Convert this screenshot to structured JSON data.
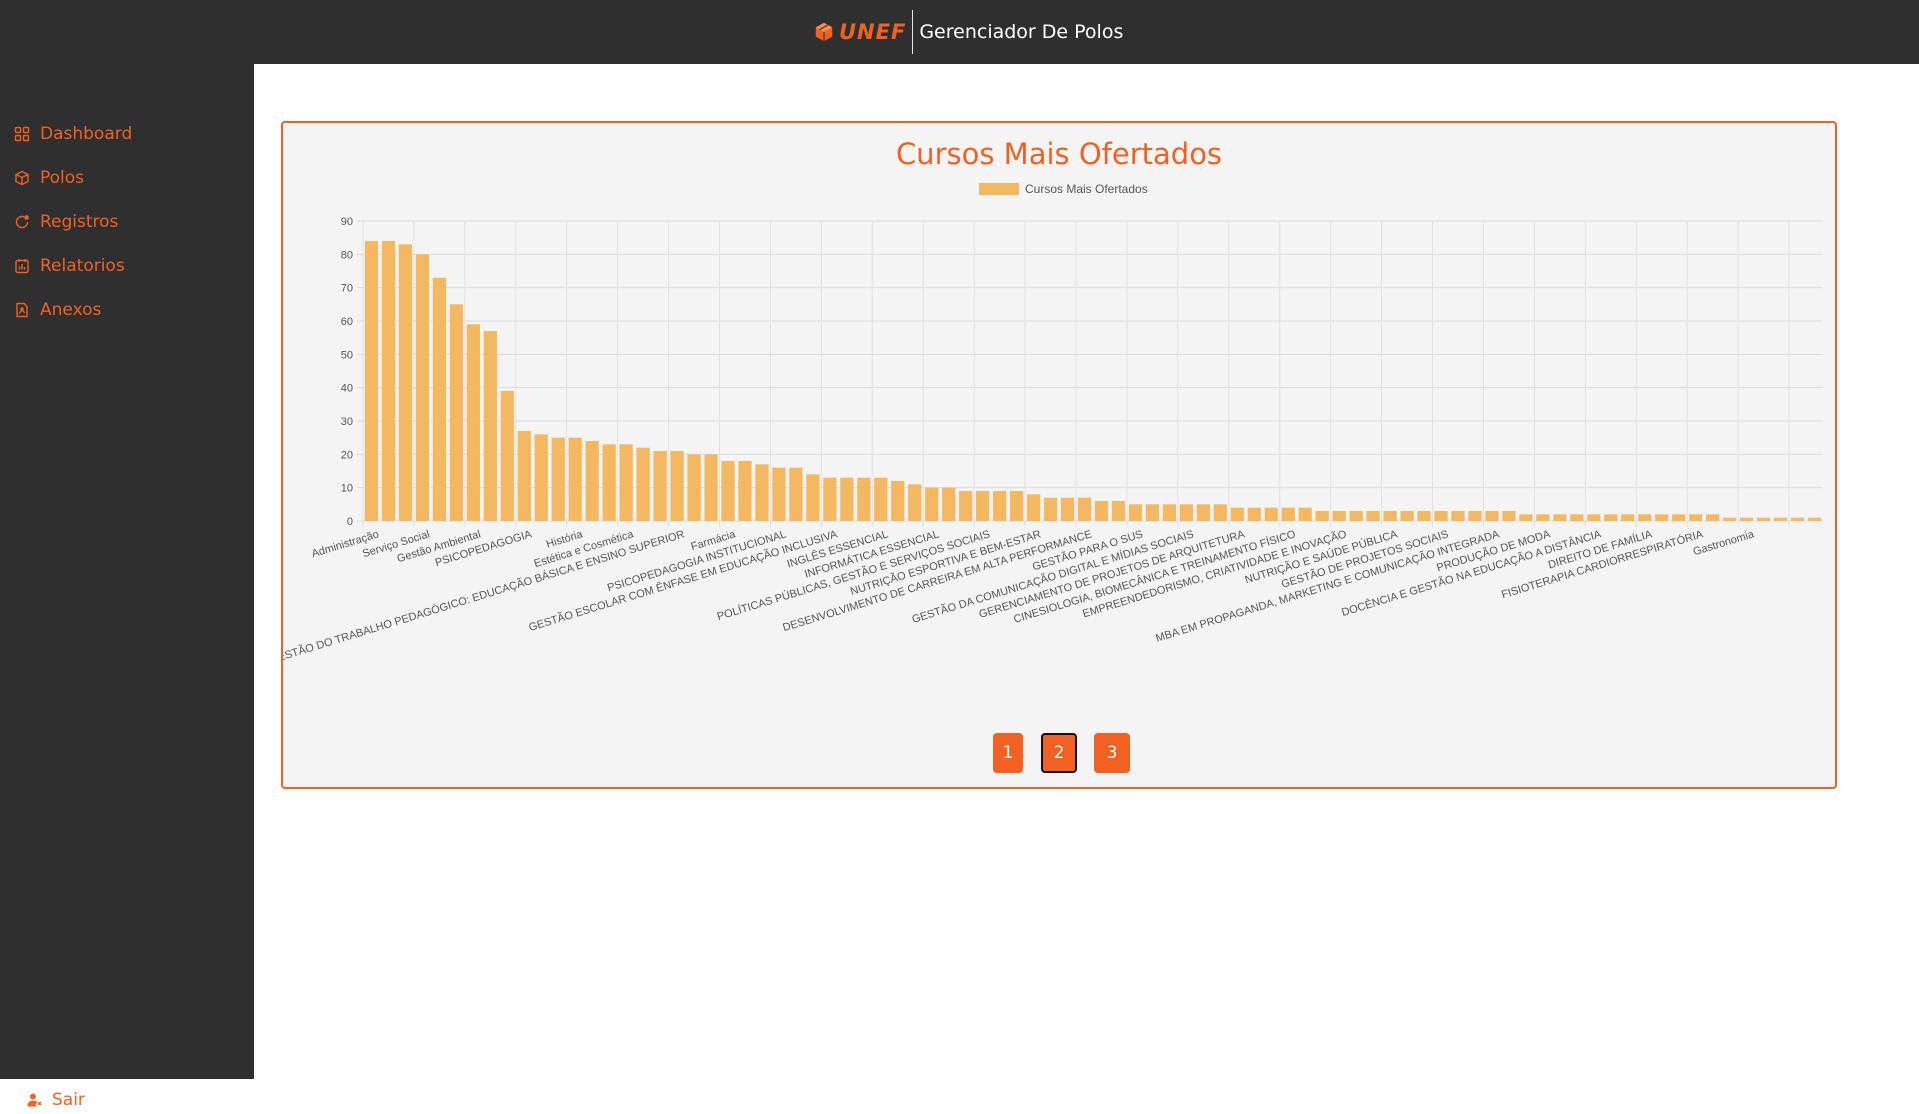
{
  "app": {
    "logo_text": "UNEF",
    "title": "Gerenciador De Polos"
  },
  "sidebar": {
    "items": [
      {
        "label": "Dashboard",
        "icon": "grid-icon"
      },
      {
        "label": "Polos",
        "icon": "cube-icon"
      },
      {
        "label": "Registros",
        "icon": "refresh-icon"
      },
      {
        "label": "Relatorios",
        "icon": "report-icon"
      },
      {
        "label": "Anexos",
        "icon": "document-icon"
      }
    ],
    "logout_label": "Sair"
  },
  "colors": {
    "accent": "#f26122",
    "bar": "#f4b860",
    "sidebar_bg": "#2f2f2f"
  },
  "pagination": {
    "pages": [
      "1",
      "2",
      "3"
    ],
    "active": "2"
  },
  "chart_data": {
    "type": "bar",
    "title": "Cursos Mais Ofertados",
    "legend": "Cursos Mais Ofertados",
    "legend_position": "top",
    "grid": true,
    "ylim": [
      0,
      90
    ],
    "yticks": [
      0,
      10,
      20,
      30,
      40,
      50,
      60,
      70,
      80,
      90
    ],
    "category_labels": [
      "Administração",
      "Serviço Social",
      "Gestão Ambiental",
      "PSICOPEDAGOGIA",
      "História",
      "Estética e Cosmética",
      "GESTÃO DO TRABALHO PEDAGÓGICO: EDUCAÇÃO BÁSICA E ENSINO SUPERIOR",
      "Farmácia",
      "PSICOPEDAGOGIA INSTITUCIONAL",
      "GESTÃO ESCOLAR COM ÊNFASE EM EDUCAÇÃO INCLUSIVA",
      "INGLÊS ESSENCIAL",
      "INFORMÁTICA ESSENCIAL",
      "POLÍTICAS PÚBLICAS, GESTÃO E SERVIÇOS SOCIAIS",
      "NUTRIÇÃO ESPORTIVA E BEM-ESTAR",
      "DESENVOLVIMENTO DE CARREIRA EM ALTA PERFORMANCE",
      "GESTÃO PARA O SUS",
      "GESTÃO DA COMUNICAÇÃO DIGITAL E MÍDIAS SOCIAIS",
      "GERENCIAMENTO DE PROJETOS DE ARQUITETURA",
      "CINESIOLOGIA, BIOMECÂNICA E TREINAMENTO FÍSICO",
      "EMPREENDEDORISMO, CRIATIVIDADE E INOVAÇÃO",
      "NUTRIÇÃO E SAÚDE PÚBLICA",
      "GESTÃO DE PROJETOS SOCIAIS",
      "MBA EM PROPAGANDA, MARKETING E COMUNICAÇÃO INTEGRADA",
      "PRODUÇÃO DE MODA",
      "DOCÊNCIA E GESTÃO NA EDUCAÇÃO A DISTÂNCIA",
      "DIREITO DE FAMÍLIA",
      "FISIOTERAPIA CARDIORRESPIRATÓRIA",
      "Gastronomia"
    ],
    "values": [
      84,
      84,
      83,
      80,
      73,
      65,
      59,
      57,
      39,
      27,
      26,
      25,
      25,
      24,
      23,
      23,
      22,
      21,
      21,
      20,
      20,
      18,
      18,
      17,
      16,
      16,
      14,
      13,
      13,
      13,
      13,
      12,
      11,
      10,
      10,
      9,
      9,
      9,
      9,
      8,
      7,
      7,
      7,
      6,
      6,
      5,
      5,
      5,
      5,
      5,
      5,
      4,
      4,
      4,
      4,
      4,
      3,
      3,
      3,
      3,
      3,
      3,
      3,
      3,
      3,
      3,
      3,
      3,
      2,
      2,
      2,
      2,
      2,
      2,
      2,
      2,
      2,
      2,
      2,
      2,
      1,
      1,
      1,
      1,
      1,
      1
    ]
  }
}
